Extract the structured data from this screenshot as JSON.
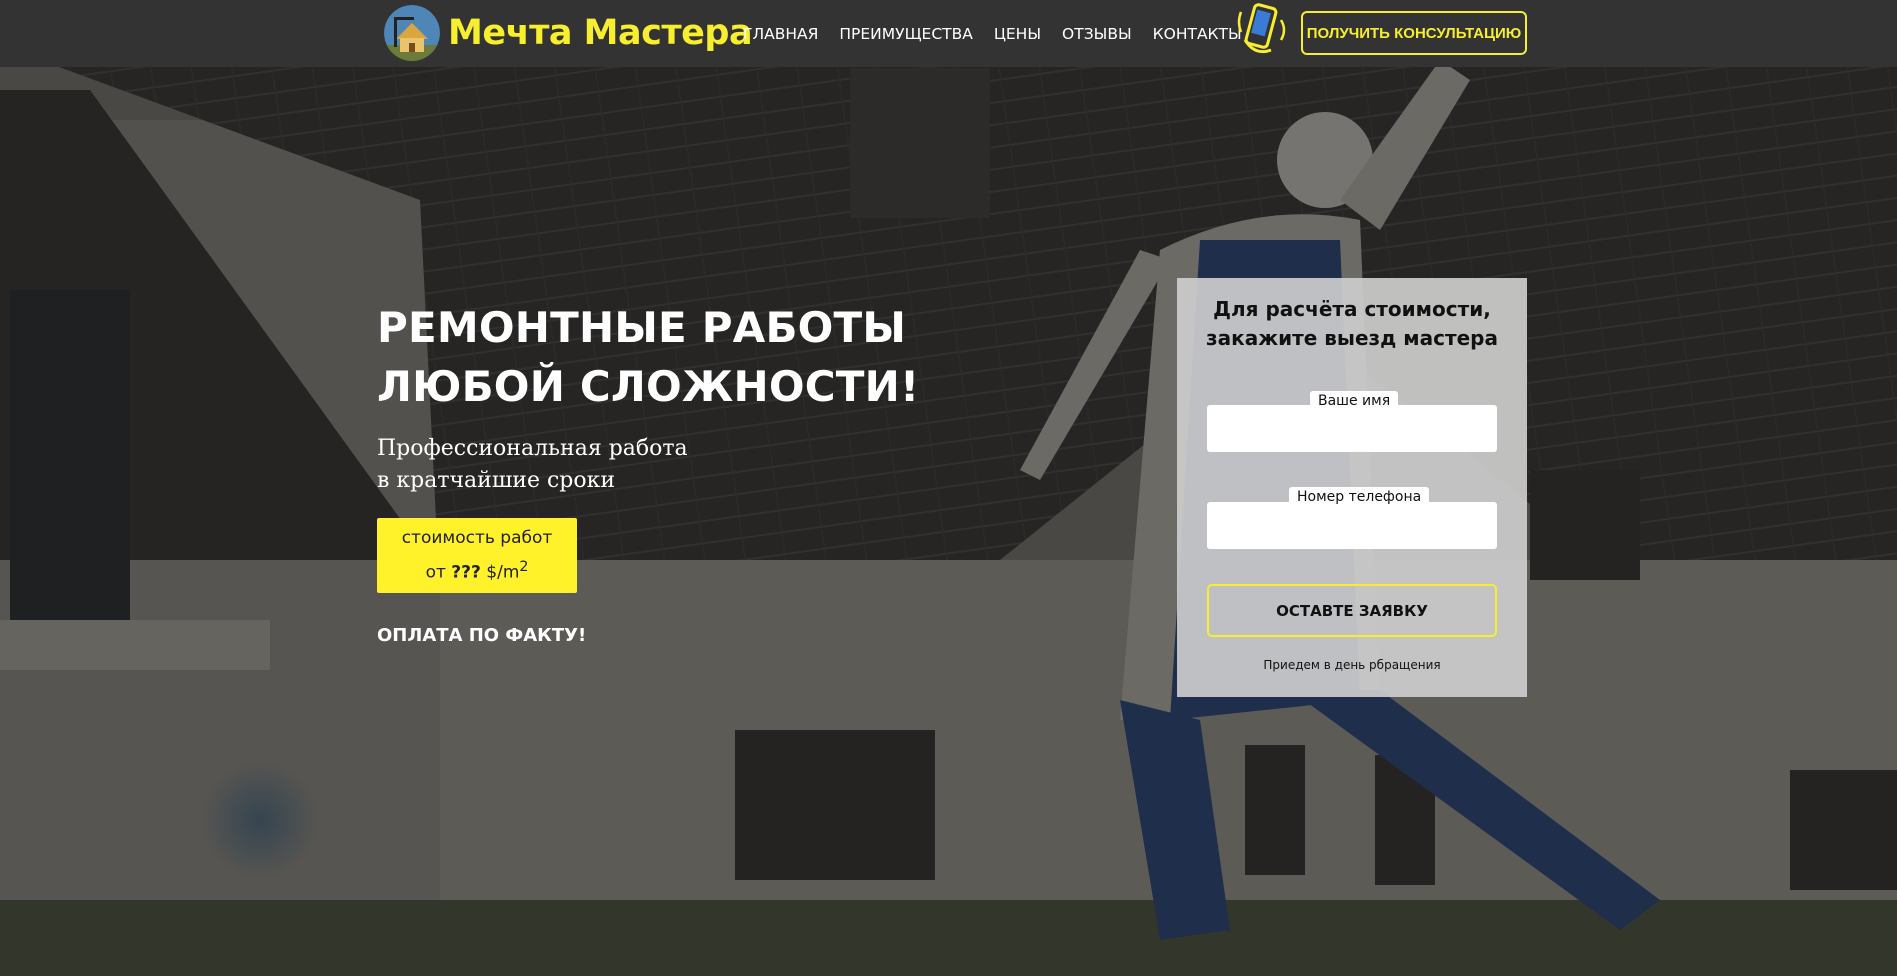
{
  "header": {
    "logo_text": "Мечта Мастера",
    "nav": [
      {
        "label": "ГЛАВНАЯ"
      },
      {
        "label": "ПРЕИМУЩЕСТВА"
      },
      {
        "label": "ЦЕНЫ"
      },
      {
        "label": "ОТЗЫВЫ"
      },
      {
        "label": "КОНТАКТЫ"
      }
    ],
    "cta_label": "ПОЛУЧИТЬ КОНСУЛЬТАЦИЮ",
    "phone_icon": "phone-icon"
  },
  "hero": {
    "title_line1": "РЕМОНТНЫЕ РАБОТЫ",
    "title_line2": "ЛЮБОЙ СЛОЖНОСТИ!",
    "subtitle_line1": "Профессиональная работа",
    "subtitle_line2": "в кратчайшие сроки",
    "price_line1": "стоимость работ",
    "price_prefix": "от ",
    "price_value": "???",
    "price_unit": " $/m",
    "price_sup": "2",
    "payment": "ОПЛАТА ПО ФАКТУ!"
  },
  "form": {
    "title_line1": "Для расчёта стоимости,",
    "title_line2": "закажите выезд мастера",
    "name_label": "Ваше имя",
    "name_value": "",
    "phone_label": "Номер телефона",
    "phone_value": "",
    "submit_label": "ОСТАВТЕ ЗАЯВКУ",
    "note": "Приедем в день рбращения"
  },
  "colors": {
    "accent": "#f6ee2f",
    "header_bg": "#333333",
    "price_bg": "#fff22a"
  }
}
